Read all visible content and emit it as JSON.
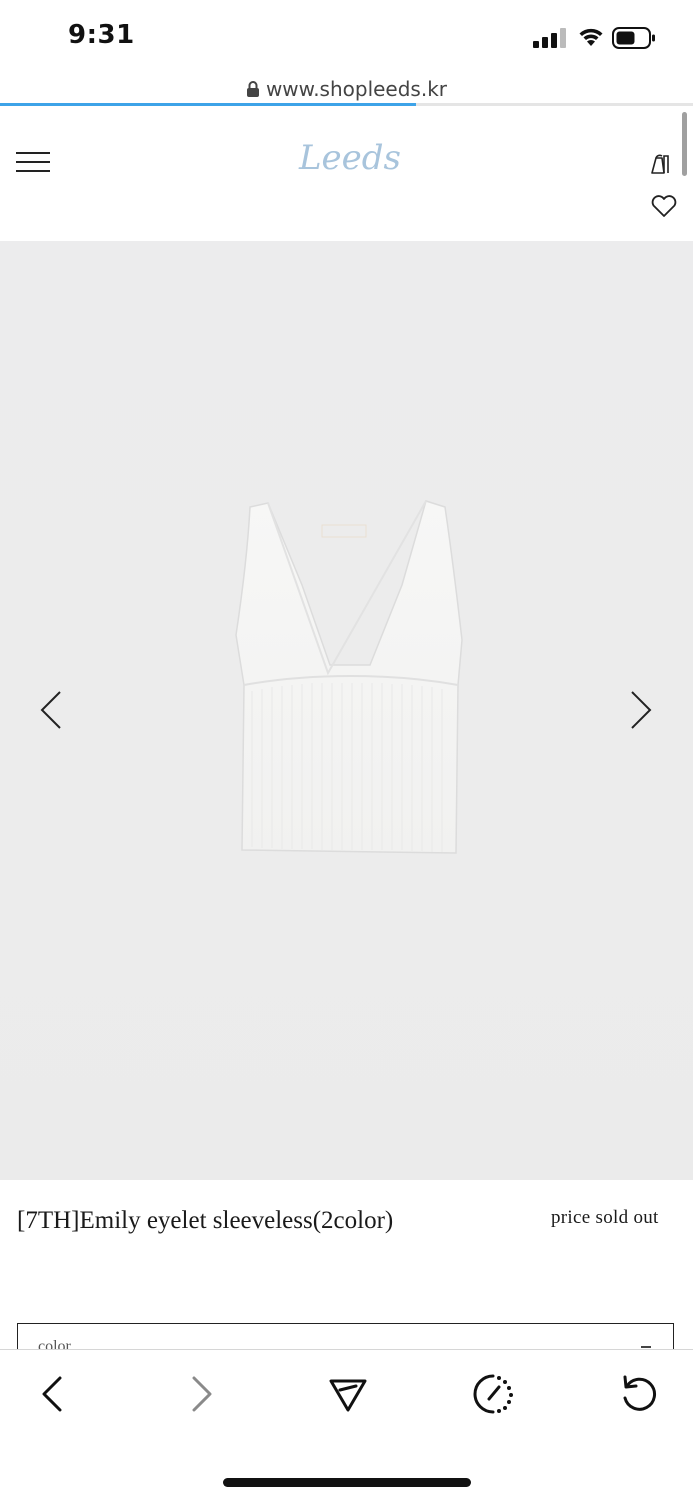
{
  "status_bar": {
    "time": "9:31"
  },
  "browser": {
    "url": "www.shopleeds.kr",
    "load_progress": 0.6
  },
  "site": {
    "logo_text": "Leeds"
  },
  "product": {
    "name": "[7TH]Emily eyelet sleeveless(2color)",
    "price": "price sold out"
  },
  "options": {
    "color_label": "color"
  },
  "icons": {
    "menu": "menu-icon",
    "bag": "shopping-bag-icon",
    "wishlist": "heart-icon",
    "prev": "chevron-left-icon",
    "next": "chevron-right-icon",
    "toolbar": [
      "back-icon",
      "forward-icon",
      "share-icon",
      "speed-icon",
      "reload-icon"
    ]
  },
  "colors": {
    "progress": "#3da3e8",
    "logo": "#a8c4dc"
  }
}
